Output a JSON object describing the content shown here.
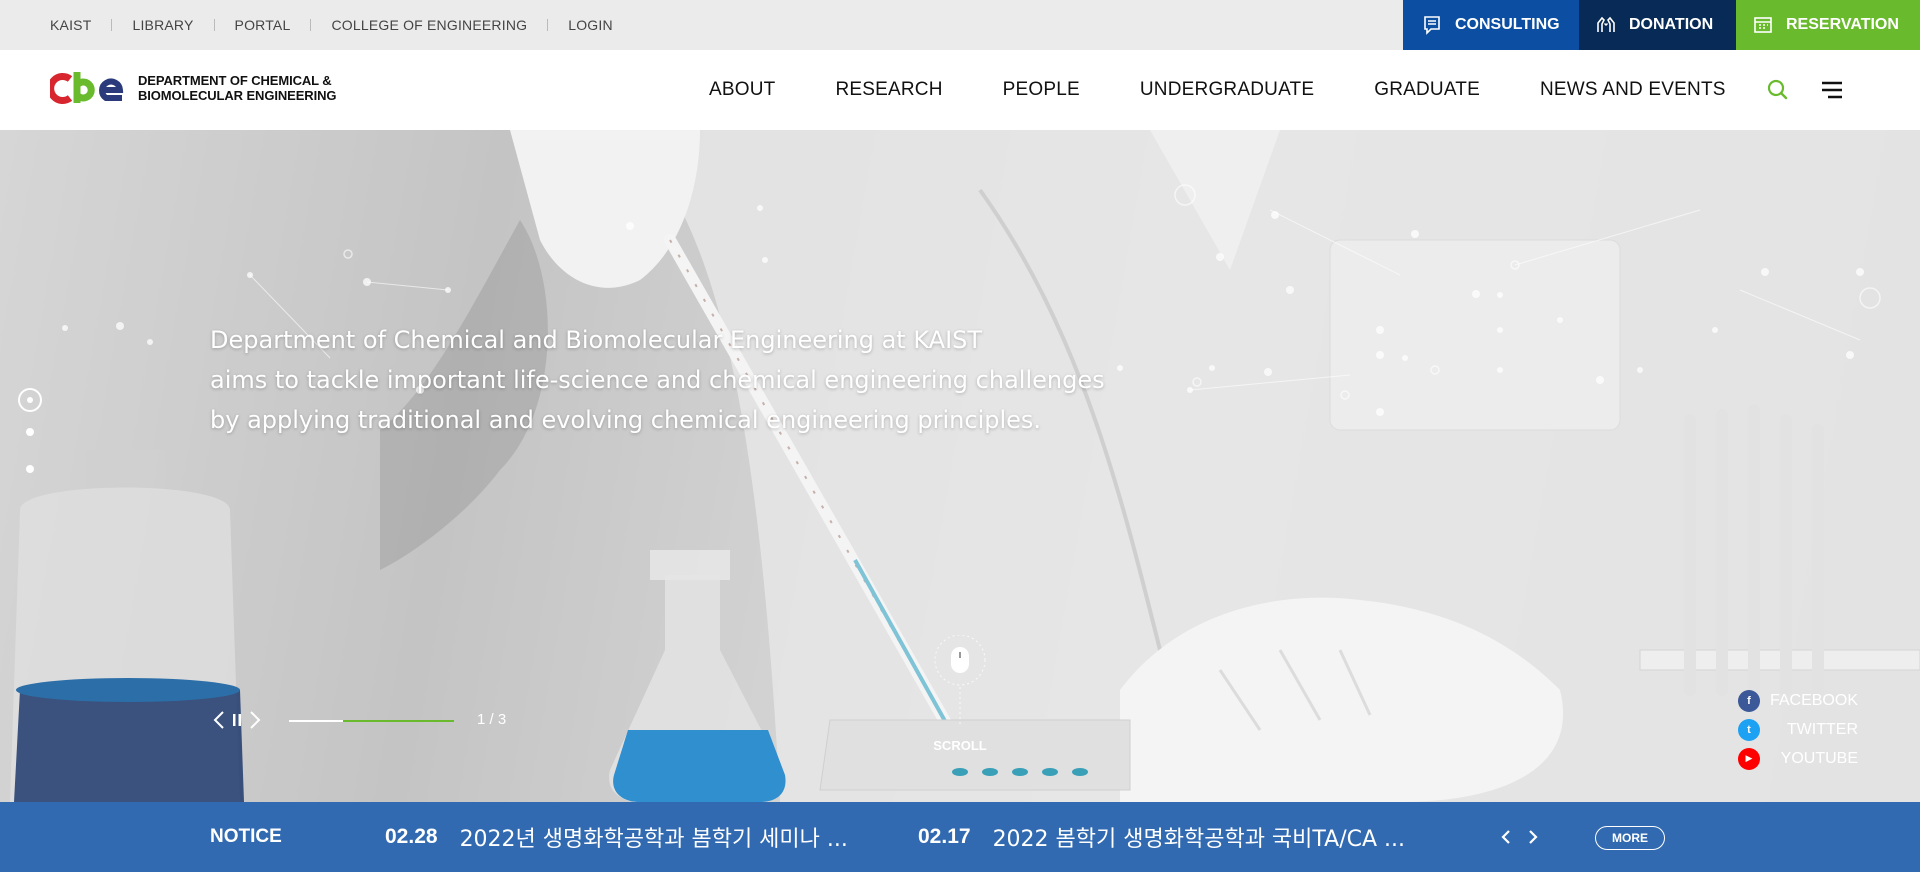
{
  "top_links": [
    "KAIST",
    "LIBRARY",
    "PORTAL",
    "COLLEGE OF ENGINEERING",
    "LOGIN"
  ],
  "quick_buttons": {
    "consulting": "CONSULTING",
    "donation": "DONATION",
    "reservation": "RESERVATION"
  },
  "colors": {
    "consulting": "#0b4ea2",
    "donation": "#082a56",
    "reservation": "#6aba2e",
    "notice_bar": "#1455a5",
    "accent_green": "#6aba2e"
  },
  "logo": {
    "mark": "CbE",
    "line1": "DEPARTMENT OF CHEMICAL &",
    "line2": "BIOMOLECULAR ENGINEERING"
  },
  "nav": [
    "ABOUT",
    "RESEARCH",
    "PEOPLE",
    "UNDERGRADUATE",
    "GRADUATE",
    "NEWS AND EVENTS"
  ],
  "header_icons": {
    "search": "search-icon",
    "menu": "hamburger-menu-icon"
  },
  "hero": {
    "lines": [
      "Department of Chemical and Biomolecular Engineering at KAIST",
      "aims to tackle important life-science and chemical engineering challenges",
      "by applying traditional and evolving chemical engineering principles."
    ],
    "slide_counter": "1 / 3",
    "slide_progress": 0.33,
    "scroll_label": "SCROLL"
  },
  "social": [
    {
      "label": "FACEBOOK",
      "icon": "facebook-icon",
      "glyph": "f",
      "color": "#3b5998"
    },
    {
      "label": "TWITTER",
      "icon": "twitter-icon",
      "glyph": "t",
      "color": "#1da1f2"
    },
    {
      "label": "YOUTUBE",
      "icon": "youtube-icon",
      "glyph": "▶",
      "color": "#ff0000"
    }
  ],
  "notice": {
    "title": "NOTICE",
    "items": [
      {
        "date": "02.28",
        "text": "2022년 생명화학공학과 봄학기 세미나 ..."
      },
      {
        "date": "02.17",
        "text": "2022 봄학기 생명화학공학과 국비TA/CA ..."
      }
    ],
    "more_label": "MORE"
  }
}
